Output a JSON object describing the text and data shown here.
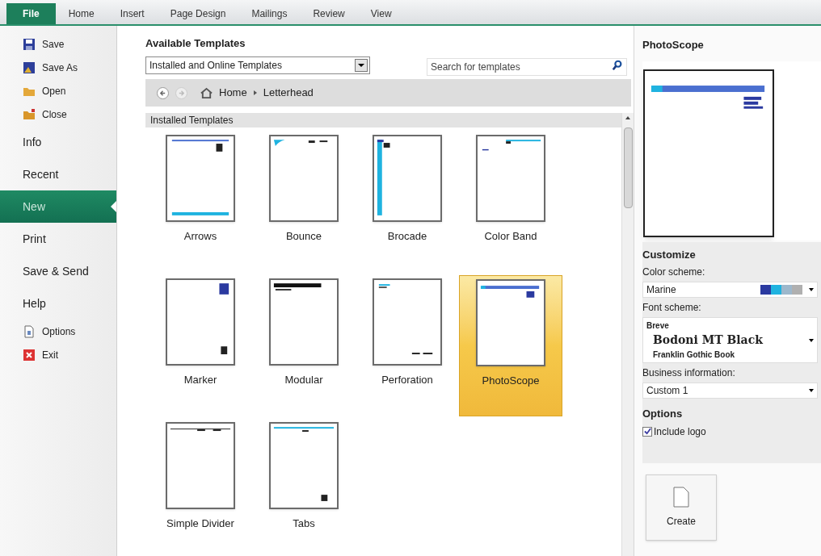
{
  "ribbon_tabs": [
    {
      "label": "File",
      "selected": true
    },
    {
      "label": "Home",
      "selected": false
    },
    {
      "label": "Insert",
      "selected": false
    },
    {
      "label": "Page Design",
      "selected": false
    },
    {
      "label": "Mailings",
      "selected": false
    },
    {
      "label": "Review",
      "selected": false
    },
    {
      "label": "View",
      "selected": false
    }
  ],
  "sidebar": {
    "items": [
      {
        "kind": "command",
        "label": "Save",
        "selected": false
      },
      {
        "kind": "command",
        "label": "Save As",
        "selected": false
      },
      {
        "kind": "command",
        "label": "Open",
        "selected": false
      },
      {
        "kind": "command",
        "label": "Close",
        "selected": false
      },
      {
        "kind": "section",
        "label": "Info",
        "selected": false
      },
      {
        "kind": "section",
        "label": "Recent",
        "selected": false
      },
      {
        "kind": "section",
        "label": "New",
        "selected": true
      },
      {
        "kind": "section",
        "label": "Print",
        "selected": false
      },
      {
        "kind": "section",
        "label": "Save & Send",
        "selected": false
      },
      {
        "kind": "section",
        "label": "Help",
        "selected": false
      },
      {
        "kind": "command",
        "label": "Options",
        "selected": false
      },
      {
        "kind": "command",
        "label": "Exit",
        "selected": false
      }
    ]
  },
  "templates": {
    "title": "Available Templates",
    "source": "Installed and Online Templates",
    "search": {
      "placeholder": "Search for templates"
    },
    "breadcrumb": [
      "Home",
      "Letterhead"
    ],
    "section": "Installed Templates",
    "items": [
      {
        "name": "Arrows",
        "selected": false
      },
      {
        "name": "Bounce",
        "selected": false
      },
      {
        "name": "Brocade",
        "selected": false
      },
      {
        "name": "Color Band",
        "selected": false
      },
      {
        "name": "Marker",
        "selected": false
      },
      {
        "name": "Modular",
        "selected": false
      },
      {
        "name": "Perforation",
        "selected": false
      },
      {
        "name": "PhotoScope",
        "selected": true
      },
      {
        "name": "Simple Divider",
        "selected": false
      },
      {
        "name": "Tabs",
        "selected": false
      }
    ]
  },
  "preview": {
    "title": "PhotoScope",
    "customize": "Customize",
    "color_scheme": {
      "label": "Color scheme:",
      "value": "Marine",
      "swatches": [
        {
          "color": "#2b3aa0"
        },
        {
          "color": "#1fb3e0"
        },
        {
          "color": "#9db8cc"
        },
        {
          "color": "#b0b0b0"
        }
      ]
    },
    "font_scheme": {
      "label": "Font scheme:",
      "name": "Breve",
      "heading": "Bodoni MT Black",
      "body": "Franklin Gothic Book"
    },
    "business_information": {
      "label": "Business information:",
      "value": "Custom 1"
    },
    "options": {
      "title": "Options",
      "include_logo": {
        "label": "Include logo",
        "checked": true
      }
    },
    "create": "Create"
  }
}
